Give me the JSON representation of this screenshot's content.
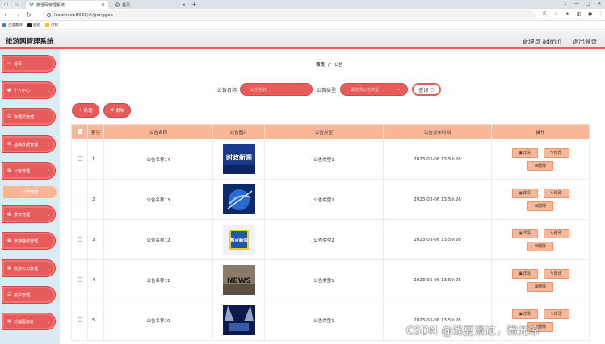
{
  "browser": {
    "tabs": [
      {
        "label": "旅游网管理系统",
        "active": true
      },
      {
        "label": "首页",
        "active": false
      }
    ],
    "url": "localhost:8081/#/gonggao",
    "bookmarks": [
      "百度翻译",
      "题钻",
      "项目"
    ]
  },
  "app": {
    "title": "旅游网管理系统",
    "user_label": "管理员 admin",
    "logout_label": "退出登录"
  },
  "sidebar": {
    "items": [
      {
        "label": "首页",
        "icon": "home-icon",
        "has_submenu": false
      },
      {
        "label": "个人中心",
        "icon": "user-icon",
        "has_submenu": true
      },
      {
        "label": "管理员管理",
        "icon": "list-icon",
        "has_submenu": true
      },
      {
        "label": "基础数据管理",
        "icon": "list-icon",
        "has_submenu": true
      },
      {
        "label": "公告管理",
        "icon": "grid-icon",
        "has_submenu": true
      },
      {
        "label": "景点管理",
        "icon": "grid-icon",
        "has_submenu": true
      },
      {
        "label": "旅游路线管理",
        "icon": "grid-icon",
        "has_submenu": true
      },
      {
        "label": "旅游公司管理",
        "icon": "grid-icon",
        "has_submenu": true
      },
      {
        "label": "用户管理",
        "icon": "list-icon",
        "has_submenu": true
      },
      {
        "label": "轮播图信息",
        "icon": "image-icon",
        "has_submenu": true
      }
    ],
    "active_submenu": "公告管理"
  },
  "breadcrumb": {
    "home": "首页",
    "separator": "//",
    "current": "公告"
  },
  "search": {
    "name_label": "公告名称",
    "name_placeholder": "公告名称",
    "type_label": "公告类型",
    "type_placeholder": "请选择公告类型",
    "search_button": "查询"
  },
  "actions": {
    "add": "新增",
    "delete": "删除"
  },
  "table": {
    "headers": [
      "索引",
      "公告名称",
      "公告图片",
      "公告类型",
      "公告发布时间",
      "操作"
    ],
    "row_actions": {
      "detail": "详情",
      "edit": "修改",
      "delete": "删除"
    },
    "rows": [
      {
        "index": "1",
        "name": "公告名称14",
        "image": "时政新闻",
        "type": "公告类型1",
        "time": "2023-03-06 13:59:26"
      },
      {
        "index": "2",
        "name": "公告名称13",
        "image": "",
        "type": "公告类型2",
        "time": "2023-03-06 13:59:26"
      },
      {
        "index": "3",
        "name": "公告名称12",
        "image": "焦点新闻",
        "type": "公告类型2",
        "time": "2023-03-06 13:59:26"
      },
      {
        "index": "4",
        "name": "公告名称11",
        "image": "NEWS",
        "type": "公告类型1",
        "time": "2023-03-06 13:59:26"
      },
      {
        "index": "5",
        "name": "公告名称10",
        "image": "",
        "type": "公告类型1",
        "time": "2023-03-06 13:59:26"
      }
    ]
  },
  "watermark": "CSDN @浅夏淡过，微光凉",
  "colors": {
    "accent": "#e85b5b",
    "header_row": "#f9b797",
    "sidebar_bg": "#d9ecf4"
  }
}
